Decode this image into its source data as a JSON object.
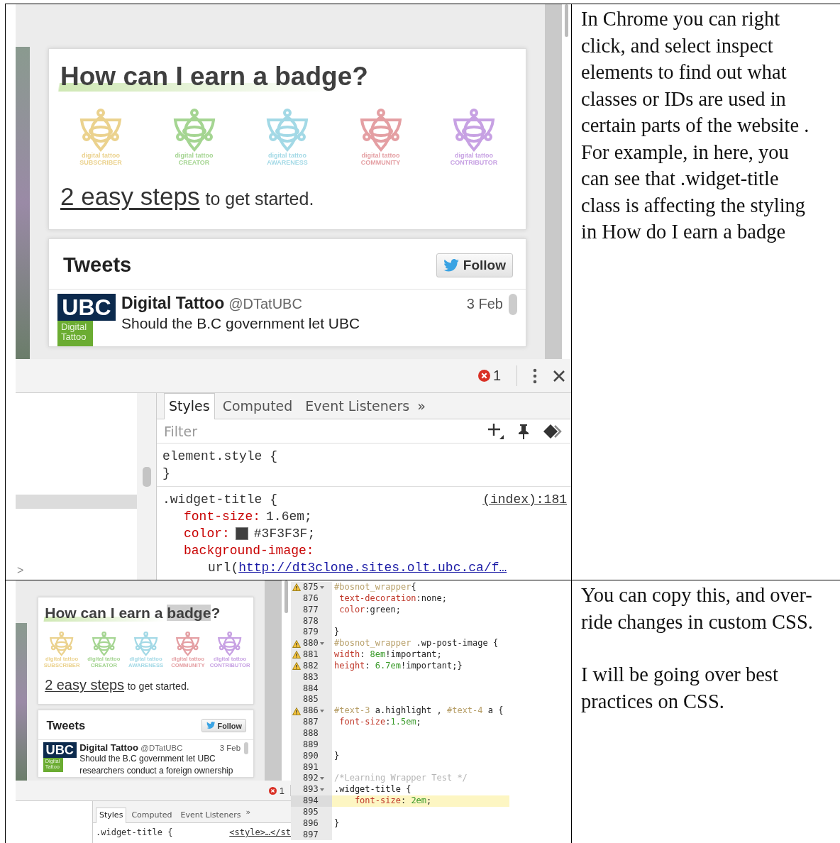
{
  "rows": [
    {
      "screenshot": {
        "kind": "devtools_styles",
        "page": {
          "title": [
            {
              "text": "How can I earn a badge?",
              "highlighted": false
            }
          ],
          "badges": [
            {
              "line_1": "digital tattoo",
              "line_2": "SUBSCRIBER",
              "color": "#ebd28e"
            },
            {
              "line_1": "digital tattoo",
              "line_2": "CREATOR",
              "color": "#a5d592"
            },
            {
              "line_1": "digital tattoo",
              "line_2": "AWARENESS",
              "color": "#a3d9e6"
            },
            {
              "line_1": "digital tattoo",
              "line_2": "COMMUNITY",
              "color": "#e49fa3"
            },
            {
              "line_1": "digital tattoo",
              "line_2": "CONTRIBUTOR",
              "color": "#c7a1e3"
            }
          ],
          "steps_link": "2 easy steps",
          "steps_text": "to get started.",
          "tweets": {
            "title": "Tweets",
            "follow": "Follow",
            "logo": "UBC",
            "logo_caption": "Digital Tattoo",
            "name": "Digital Tattoo",
            "handle": "@DTatUBC",
            "date": "3 Feb",
            "lines": [
              "Should the B.C government let UBC"
            ]
          }
        },
        "devtools": {
          "error_count": "1",
          "tabs": [
            {
              "label": "Styles",
              "selected": true
            },
            {
              "label": "Computed",
              "selected": false
            },
            {
              "label": "Event Listeners",
              "selected": false
            }
          ],
          "more": "»",
          "filter_placeholder": "Filter",
          "prompt": ">",
          "rules": [
            {
              "selector": "element.style {",
              "close": "}"
            },
            {
              "selector": ".widget-title {",
              "source": "(index):181",
              "declarations": [
                {
                  "property": "font-size:",
                  "value": "1.6em;"
                },
                {
                  "property": "color:",
                  "value": "#3F3F3F;",
                  "kind": "color"
                },
                {
                  "property": "background-image:"
                }
              ],
              "url_prefix": "url(",
              "url": "http://dt3clone.sites.olt.ubc.ca/f…"
            }
          ]
        }
      },
      "note": [
        "In Chrome you can right click, and select inspect elements to find out what classes or IDs are used in certain parts of the website . For example, in here, you can see that .widget-title class is affecting the styling in How do I earn a badge"
      ]
    },
    {
      "screenshot": {
        "kind": "code_editor",
        "page": {
          "title": [
            {
              "text": "How can I earn a ",
              "highlighted": false
            },
            {
              "text": "badge",
              "highlighted": true
            },
            {
              "text": "?",
              "highlighted": false
            }
          ],
          "badges": [
            {
              "line_1": "digital tattoo",
              "line_2": "SUBSCRIBER",
              "color": "#ebd28e"
            },
            {
              "line_1": "digital tattoo",
              "line_2": "CREATOR",
              "color": "#a5d592"
            },
            {
              "line_1": "digital tattoo",
              "line_2": "AWARENESS",
              "color": "#a3d9e6"
            },
            {
              "line_1": "digital tattoo",
              "line_2": "COMMUNITY",
              "color": "#e49fa3"
            },
            {
              "line_1": "digital tattoo",
              "line_2": "CONTRIBUTOR",
              "color": "#c7a1e3"
            }
          ],
          "steps_link": "2 easy steps",
          "steps_text": "to get started.",
          "tweets": {
            "title": "Tweets",
            "follow": "Follow",
            "logo": "UBC",
            "logo_caption": "Digital Tattoo",
            "name": "Digital Tattoo",
            "handle": "@DTatUBC",
            "date": "3 Feb",
            "lines": [
              "Should the B.C government let UBC",
              "researchers conduct a foreign ownership"
            ]
          }
        },
        "devtools": {
          "error_count": "1",
          "tabs": [
            {
              "label": "Styles",
              "selected": true
            },
            {
              "label": "Computed",
              "selected": false
            },
            {
              "label": "Event Listeners",
              "selected": false
            }
          ],
          "more": "»",
          "selector": ".widget-title {",
          "source": "<style>…</st"
        },
        "editor": [
          {
            "number": "875",
            "warning": true,
            "fold": true,
            "highlighted": false,
            "tokens": [
              {
                "text": "#bosnot_wrapper",
                "kind": "id"
              },
              {
                "text": "{",
                "kind": "plain"
              }
            ]
          },
          {
            "number": "876",
            "warning": false,
            "fold": false,
            "highlighted": false,
            "tokens": [
              {
                "text": " text-decoration",
                "kind": "property"
              },
              {
                "text": ":none;",
                "kind": "plain"
              }
            ]
          },
          {
            "number": "877",
            "warning": false,
            "fold": false,
            "highlighted": false,
            "tokens": [
              {
                "text": " color",
                "kind": "property"
              },
              {
                "text": ":green;",
                "kind": "plain"
              }
            ]
          },
          {
            "number": "878",
            "warning": false,
            "fold": false,
            "highlighted": false
          },
          {
            "number": "879",
            "warning": false,
            "fold": false,
            "highlighted": false,
            "tokens": [
              {
                "text": "}",
                "kind": "plain"
              }
            ]
          },
          {
            "number": "880",
            "warning": true,
            "fold": true,
            "highlighted": false,
            "tokens": [
              {
                "text": "#bosnot_wrapper",
                "kind": "id"
              },
              {
                "text": " .wp-post-image {",
                "kind": "plain"
              }
            ]
          },
          {
            "number": "881",
            "warning": true,
            "fold": false,
            "highlighted": false,
            "tokens": [
              {
                "text": "width",
                "kind": "property"
              },
              {
                "text": ": ",
                "kind": "plain"
              },
              {
                "text": "8em",
                "kind": "number"
              },
              {
                "text": "!important;",
                "kind": "plain"
              }
            ]
          },
          {
            "number": "882",
            "warning": true,
            "fold": false,
            "highlighted": false,
            "tokens": [
              {
                "text": "height",
                "kind": "property"
              },
              {
                "text": ": ",
                "kind": "plain"
              },
              {
                "text": "6.7em",
                "kind": "number"
              },
              {
                "text": "!important;}",
                "kind": "plain"
              }
            ]
          },
          {
            "number": "883",
            "warning": false,
            "fold": false,
            "highlighted": false
          },
          {
            "number": "884",
            "warning": false,
            "fold": false,
            "highlighted": false
          },
          {
            "number": "885",
            "warning": false,
            "fold": false,
            "highlighted": false
          },
          {
            "number": "886",
            "warning": true,
            "fold": true,
            "highlighted": false,
            "tokens": [
              {
                "text": "#text-3",
                "kind": "id"
              },
              {
                "text": " a.highlight , ",
                "kind": "plain"
              },
              {
                "text": "#text-4",
                "kind": "id"
              },
              {
                "text": " a {",
                "kind": "plain"
              }
            ]
          },
          {
            "number": "887",
            "warning": false,
            "fold": false,
            "highlighted": false,
            "tokens": [
              {
                "text": " font-size",
                "kind": "property"
              },
              {
                "text": ":",
                "kind": "plain"
              },
              {
                "text": "1.5em",
                "kind": "number"
              },
              {
                "text": ";",
                "kind": "plain"
              }
            ]
          },
          {
            "number": "888",
            "warning": false,
            "fold": false,
            "highlighted": false
          },
          {
            "number": "889",
            "warning": false,
            "fold": false,
            "highlighted": false
          },
          {
            "number": "890",
            "warning": false,
            "fold": false,
            "highlighted": false,
            "tokens": [
              {
                "text": "}",
                "kind": "plain"
              }
            ]
          },
          {
            "number": "891",
            "warning": false,
            "fold": false,
            "highlighted": false
          },
          {
            "number": "892",
            "warning": false,
            "fold": true,
            "highlighted": false,
            "tokens": [
              {
                "text": "/*Learning Wrapper Test */",
                "kind": "comment"
              }
            ]
          },
          {
            "number": "893",
            "warning": false,
            "fold": true,
            "highlighted": false,
            "tokens": [
              {
                "text": ".widget-title {",
                "kind": "plain"
              }
            ]
          },
          {
            "number": "894",
            "warning": false,
            "fold": false,
            "highlighted": true,
            "tokens": [
              {
                "text": "    font-size",
                "kind": "property"
              },
              {
                "text": ": ",
                "kind": "plain"
              },
              {
                "text": "2em",
                "kind": "number"
              },
              {
                "text": ";",
                "kind": "plain"
              }
            ]
          },
          {
            "number": "895",
            "warning": false,
            "fold": false,
            "highlighted": false
          },
          {
            "number": "896",
            "warning": false,
            "fold": false,
            "highlighted": false,
            "tokens": [
              {
                "text": "}",
                "kind": "plain"
              }
            ]
          },
          {
            "number": "897",
            "warning": false,
            "fold": false,
            "highlighted": false
          }
        ]
      },
      "note": [
        "You can copy this, and over-ride changes in custom CSS.",
        "I will be going over best practices on CSS."
      ]
    }
  ]
}
